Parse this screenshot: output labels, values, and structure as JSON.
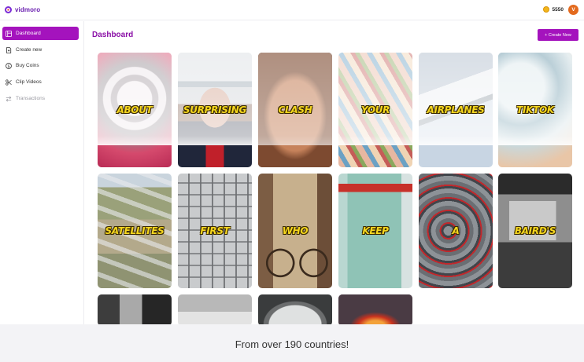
{
  "brand": {
    "name": "vidmoro"
  },
  "header": {
    "coins": "5550",
    "avatar_initial": "V"
  },
  "sidebar": {
    "items": [
      {
        "label": "Dashboard",
        "icon": "dashboard-icon",
        "active": true
      },
      {
        "label": "Create new",
        "icon": "file-plus-icon"
      },
      {
        "label": "Buy Coins",
        "icon": "dollar-icon"
      },
      {
        "label": "Clip Videos",
        "icon": "scissors-icon"
      },
      {
        "label": "Transactions",
        "icon": "transfer-icon",
        "disabled": true
      }
    ]
  },
  "main": {
    "title": "Dashboard",
    "create_label": "+ Create New",
    "cards": [
      {
        "label": "ABOUT"
      },
      {
        "label": "SURPRISING"
      },
      {
        "label": "CLASH"
      },
      {
        "label": "YOUR"
      },
      {
        "label": "AIRPLANES"
      },
      {
        "label": "TIKTOK"
      },
      {
        "label": "SATELLITES"
      },
      {
        "label": "FIRST"
      },
      {
        "label": "WHO"
      },
      {
        "label": "KEEP"
      },
      {
        "label": "A"
      },
      {
        "label": "BAIRD'S"
      },
      {
        "label": ""
      },
      {
        "label": ""
      },
      {
        "label": ""
      },
      {
        "label": ""
      }
    ]
  },
  "footer": {
    "text": "From over 190 countries!"
  },
  "colors": {
    "accent": "#a413bd",
    "title": "#8a0fa6",
    "caption": "#f5d61e"
  }
}
